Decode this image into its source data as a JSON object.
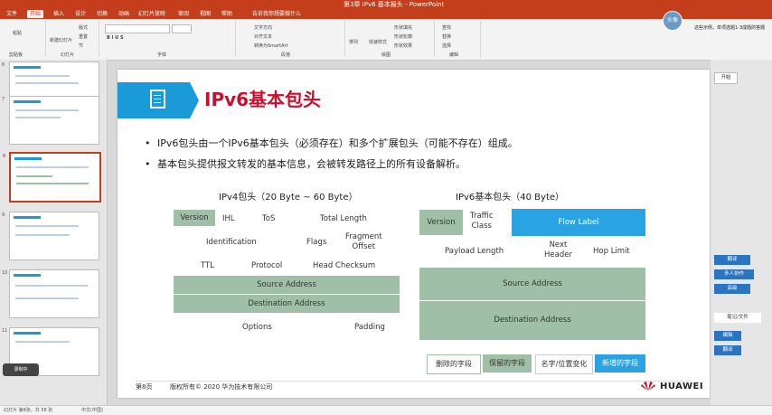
{
  "window": {
    "title": "第3章 IPv6 基本报头 - PowerPoint"
  },
  "tabs": [
    "文件",
    "开始",
    "插入",
    "设计",
    "切换",
    "动画",
    "幻灯片放映",
    "审阅",
    "视图",
    "帮助",
    "告诉我你想要做什么"
  ],
  "ribbon": {
    "groups": [
      "剪贴板",
      "幻灯片",
      "字体",
      "段落",
      "绘图",
      "编辑"
    ],
    "items": [
      "粘贴",
      "新建幻灯片",
      "版式",
      "重置",
      "节",
      "文字方向",
      "对齐文本",
      "转换为SmartArt",
      "查找",
      "替换",
      "选择",
      "形状填充",
      "形状轮廓",
      "形状效果",
      "排列",
      "快速样式"
    ]
  },
  "user": {
    "avatar": "头像",
    "tip": "这些示例，单项选题1-3成题的答题"
  },
  "thumbnails": [
    {
      "num": "6"
    },
    {
      "num": "7"
    },
    {
      "num": "8"
    },
    {
      "num": "9"
    },
    {
      "num": "10"
    },
    {
      "num": "11"
    }
  ],
  "slide": {
    "title": "IPv6基本包头",
    "bullets": [
      "IPv6包头由一个IPv6基本包头（必须存在）和多个扩展包头（可能不存在）组成。",
      "基本包头提供报文转发的基本信息，会被转发路径上的所有设备解析。"
    ],
    "ipv4": {
      "header": "IPv4包头（20 Byte ~ 60 Byte）",
      "fields": {
        "version": "Version",
        "ihl": "IHL",
        "tos": "ToS",
        "total_length": "Total Length",
        "identification": "Identification",
        "flags": "Flags",
        "fragment_offset": "Fragment\nOffset",
        "ttl": "TTL",
        "protocol": "Protocol",
        "head_checksum": "Head Checksum",
        "source": "Source Address",
        "destination": "Destination Address",
        "options": "Options",
        "padding": "Padding"
      }
    },
    "ipv6": {
      "header": "IPv6基本包头（40 Byte）",
      "fields": {
        "version": "Version",
        "traffic_class": "Traffic\nClass",
        "flow_label": "Flow Label",
        "payload_length": "Payload Length",
        "next_header": "Next\nHeader",
        "hop_limit": "Hop Limit",
        "source": "Source Address",
        "destination": "Destination Address"
      }
    },
    "legend": [
      "删除的字段",
      "保留的字段",
      "名字/位置变化",
      "新增的字段"
    ],
    "footer": {
      "page": "第8页",
      "copyright": "版权所有© 2020 华为技术有限公司",
      "brand": "HUAWEI"
    }
  },
  "right_pane": {
    "buttons": [
      "开始",
      "翻译",
      "多人协作",
      "高级",
      "笔记/文件",
      "编辑",
      "翻译"
    ]
  },
  "status": {
    "left": "幻灯片 第8张，共 58 张",
    "lang": "中文(中国)",
    "camera": "录制中"
  },
  "colors": {
    "accent": "#c43e1c",
    "brand_blue": "#1a9ad6",
    "green_field": "#9fc0a6",
    "blue_field": "#29a3e2",
    "title_red": "#c8102e"
  }
}
